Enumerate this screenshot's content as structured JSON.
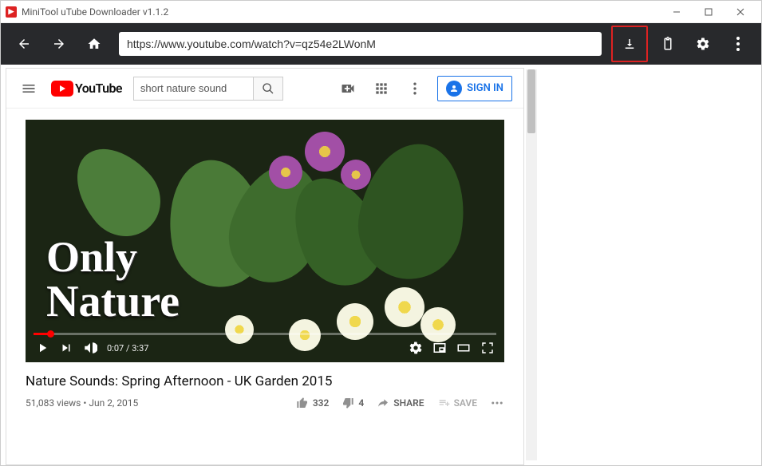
{
  "window": {
    "title": "MiniTool uTube Downloader v1.1.2"
  },
  "toolbar": {
    "url": "https://www.youtube.com/watch?v=qz54e2LWonM"
  },
  "youtube": {
    "brand": "YouTube",
    "search_value": "short nature sound",
    "sign_in": "SIGN IN"
  },
  "video": {
    "overlay_line1": "Only",
    "overlay_line2": "Nature",
    "time_current": "0:07",
    "time_separator": " / ",
    "time_total": "3:37",
    "title": "Nature Sounds: Spring Afternoon - UK Garden 2015",
    "views": "51,083 views",
    "date": "Jun 2, 2015",
    "meta_sep": " • ",
    "likes": "332",
    "dislikes": "4",
    "share_label": "SHARE",
    "save_label": "SAVE"
  }
}
